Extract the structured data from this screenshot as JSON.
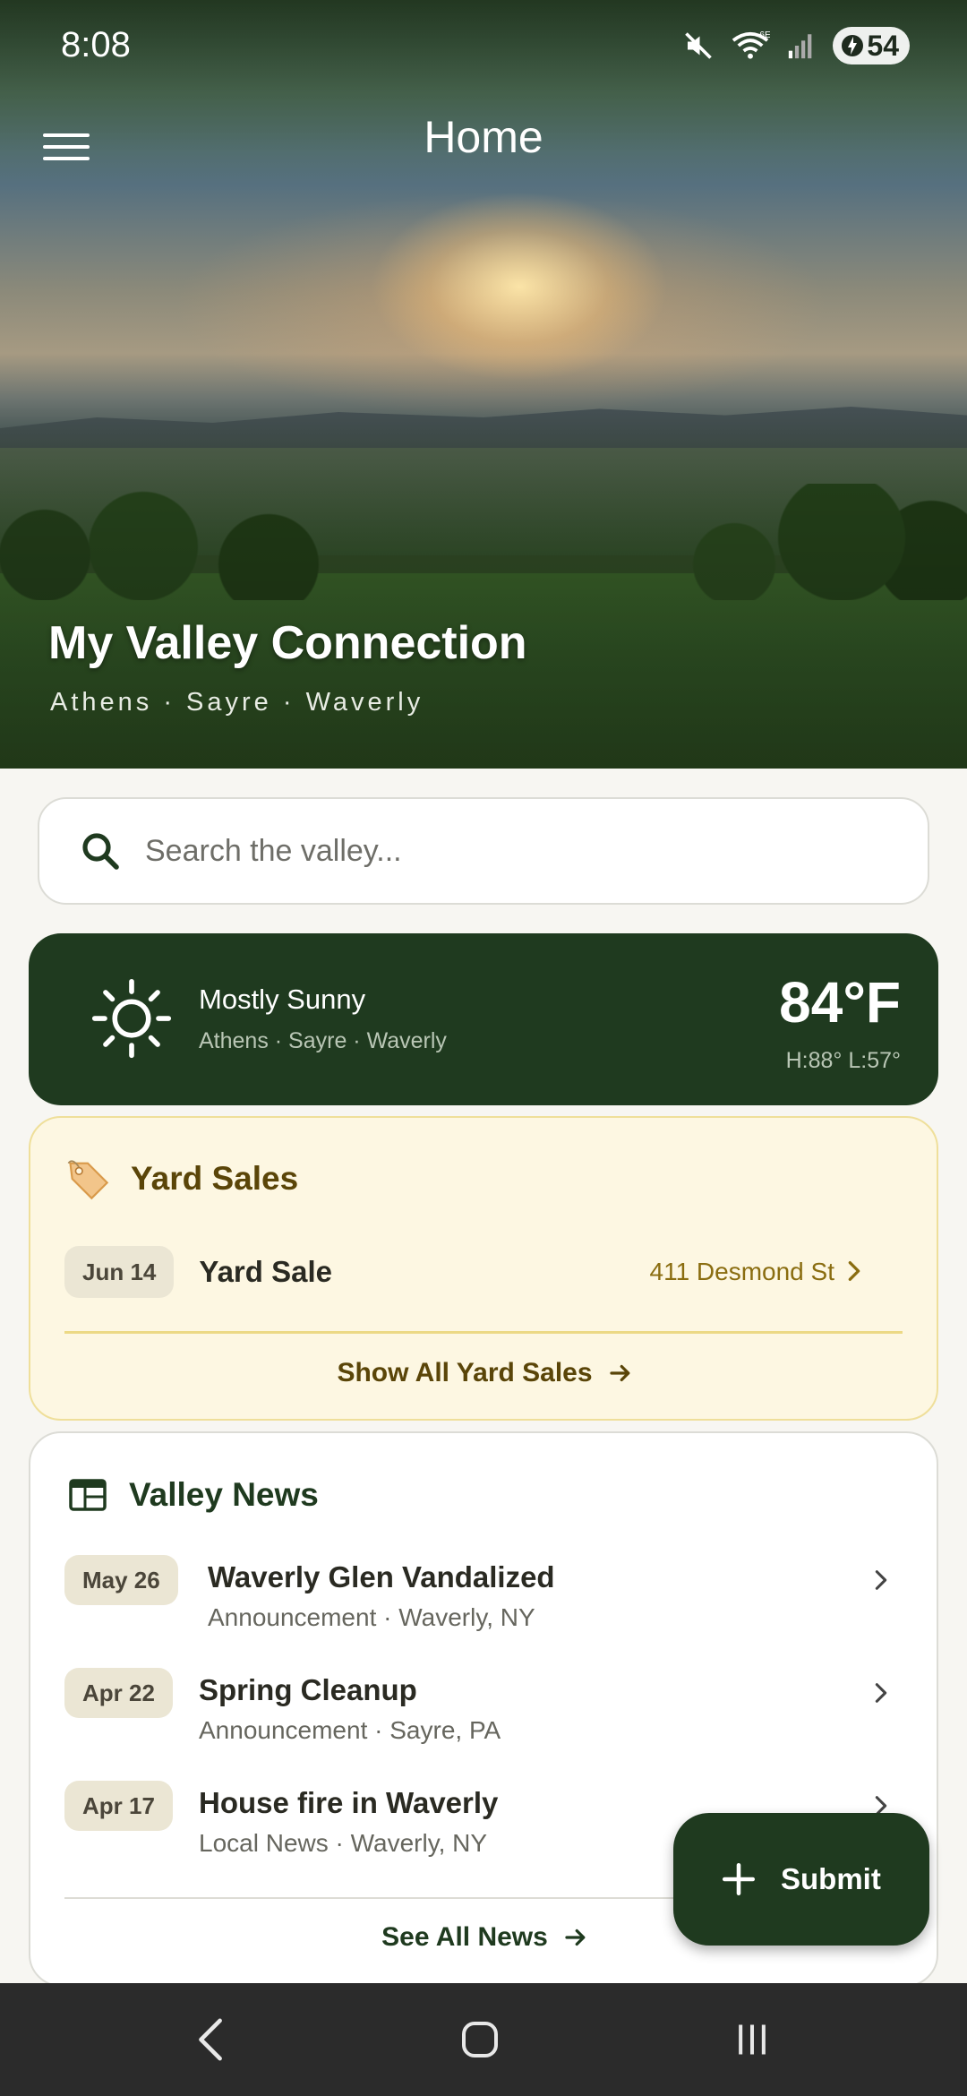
{
  "status_bar": {
    "time": "8:08",
    "battery": "54",
    "network": "6E"
  },
  "header": {
    "title": "Home",
    "menu_icon": "hamburger-menu-icon"
  },
  "hero": {
    "title": "My Valley Connection",
    "subtitle": "Athens · Sayre · Waverly"
  },
  "search": {
    "placeholder": "Search the valley...",
    "value": "",
    "icon": "search-icon"
  },
  "weather": {
    "condition": "Mostly Sunny",
    "location": "Athens · Sayre · Waverly",
    "temperature": "84°F",
    "high_low": "H:88°  L:57°",
    "icon": "sun-icon"
  },
  "yard_sales": {
    "title": "Yard Sales",
    "icon": "price-tag-icon",
    "items": [
      {
        "date": "Jun 14",
        "name": "Yard Sale",
        "address": "411 Desmond St"
      }
    ],
    "show_all_label": "Show All Yard Sales"
  },
  "news": {
    "title": "Valley News",
    "icon": "newspaper-icon",
    "items": [
      {
        "date": "May 26",
        "title": "Waverly Glen Vandalized",
        "meta": "Announcement · Waverly, NY"
      },
      {
        "date": "Apr 22",
        "title": "Spring Cleanup",
        "meta": "Announcement · Sayre, PA"
      },
      {
        "date": "Apr 17",
        "title": "House fire in Waverly",
        "meta": "Local News · Waverly, NY"
      }
    ],
    "see_all_label": "See All News"
  },
  "fab": {
    "label": "Submit",
    "icon": "plus-icon"
  },
  "colors": {
    "primary": "#1f3a1f",
    "yard_bg": "#fdf7e2",
    "yard_accent": "#5a4508",
    "address": "#8a6d10"
  }
}
